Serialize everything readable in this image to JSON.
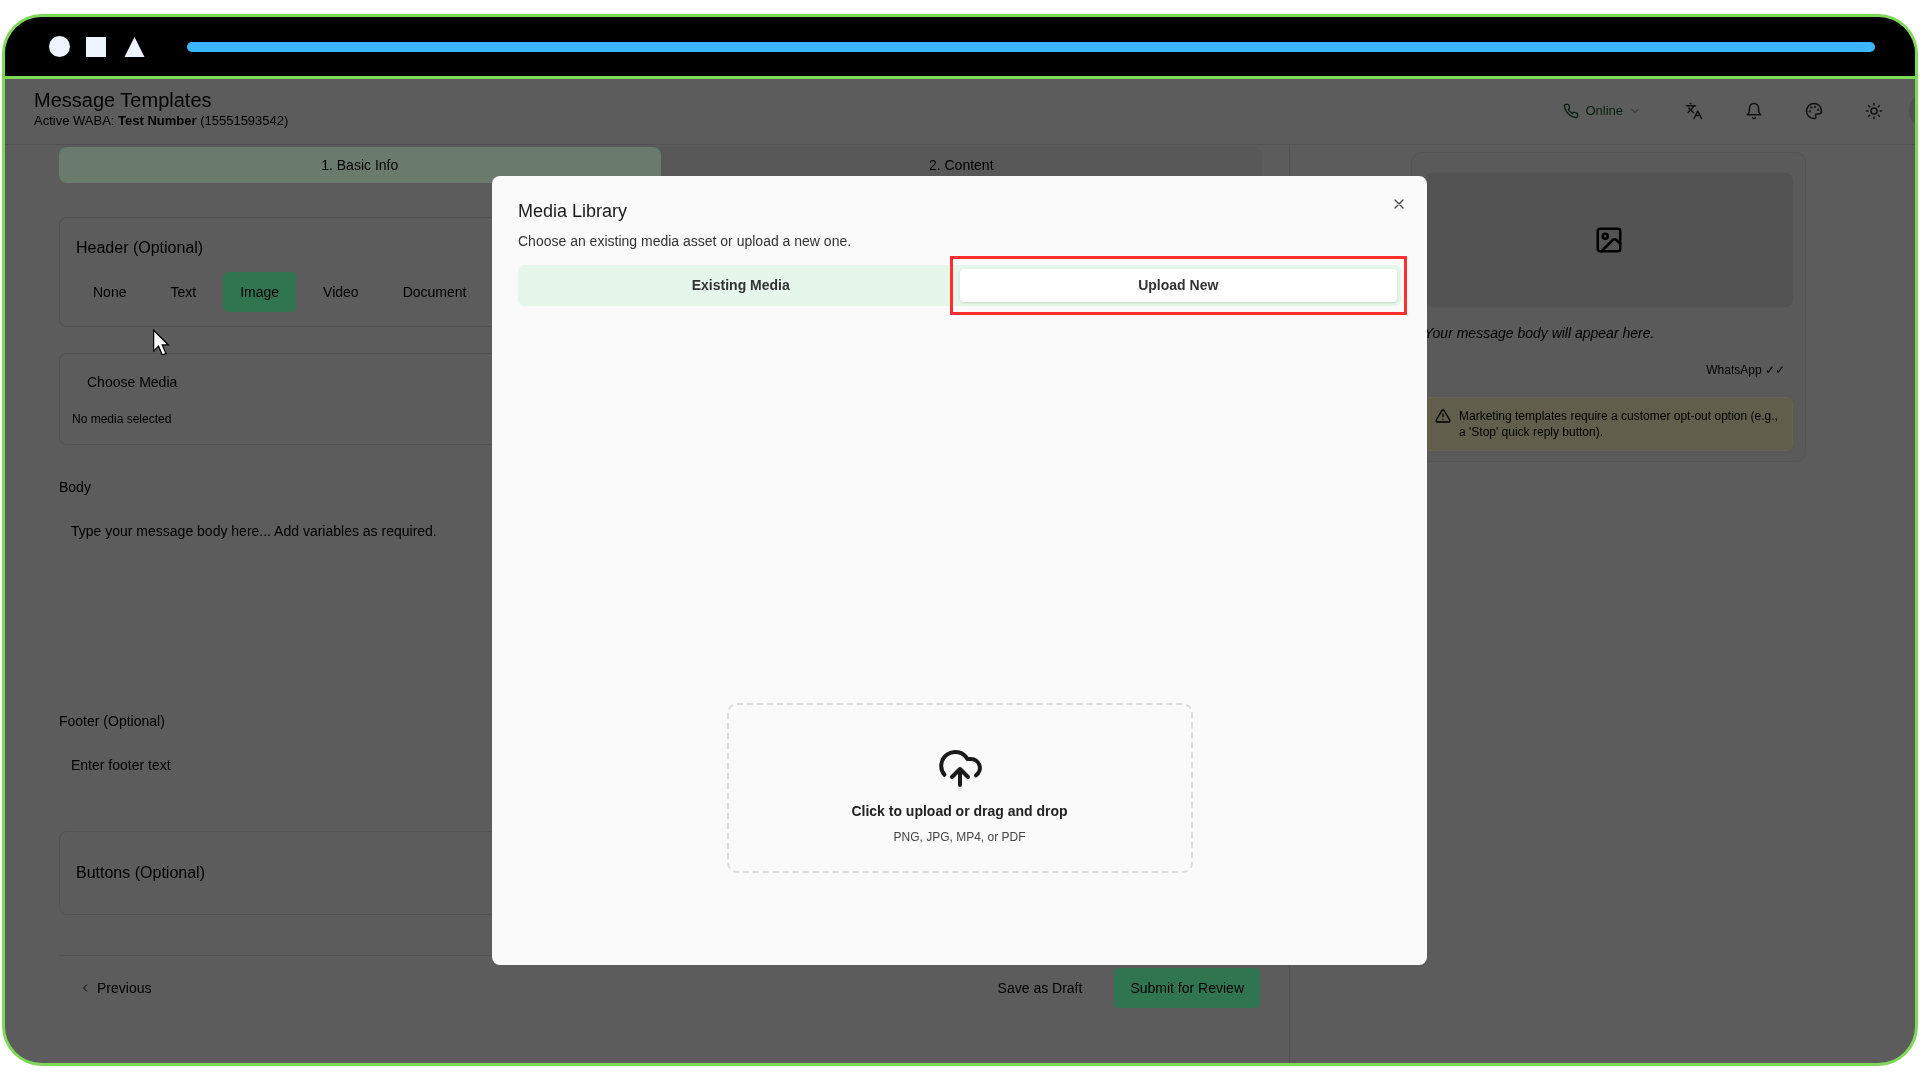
{
  "progress": {
    "level": 1
  },
  "page": {
    "title": "Message Templates",
    "subtitle": "Active WABA: **Test Number** (15551593542)"
  },
  "status": {
    "label": "Online"
  },
  "steps": [
    {
      "label": "1. Basic Info",
      "selected": true
    },
    {
      "label": "2. Content",
      "selected": false
    }
  ],
  "header_section": {
    "title": "Header (Optional)",
    "options": [
      {
        "label": "None",
        "selected": false
      },
      {
        "label": "Text",
        "selected": false
      },
      {
        "label": "Image",
        "selected": true
      },
      {
        "label": "Video",
        "selected": false
      },
      {
        "label": "Document",
        "selected": false
      }
    ]
  },
  "media": {
    "button": "Choose Media",
    "status": "No media selected"
  },
  "body": {
    "label": "Body",
    "placeholder": "Type your message body here... Add variables as required."
  },
  "footer": {
    "label": "Footer (Optional)",
    "placeholder": "Enter footer text"
  },
  "buttons_section": {
    "title": "Buttons (Optional)"
  },
  "actions": {
    "previous": "Previous",
    "draft": "Save as Draft",
    "submit": "Submit for Review"
  },
  "preview": {
    "body": "Your message body will appear here.",
    "meta": "WhatsApp ✓✓",
    "warning": "Marketing templates require a customer opt-out option (e.g., a 'Stop' quick reply button)."
  },
  "dialog": {
    "title": "Media Library",
    "description": "Choose an existing media asset or upload a new one.",
    "tabs": [
      {
        "label": "Existing Media",
        "selected": false,
        "highlighted": false
      },
      {
        "label": "Upload New",
        "selected": true,
        "highlighted": true
      }
    ],
    "upload": {
      "title": "Click to upload or drag and drop",
      "hint": "PNG, JPG, MP4, or PDF"
    }
  }
}
